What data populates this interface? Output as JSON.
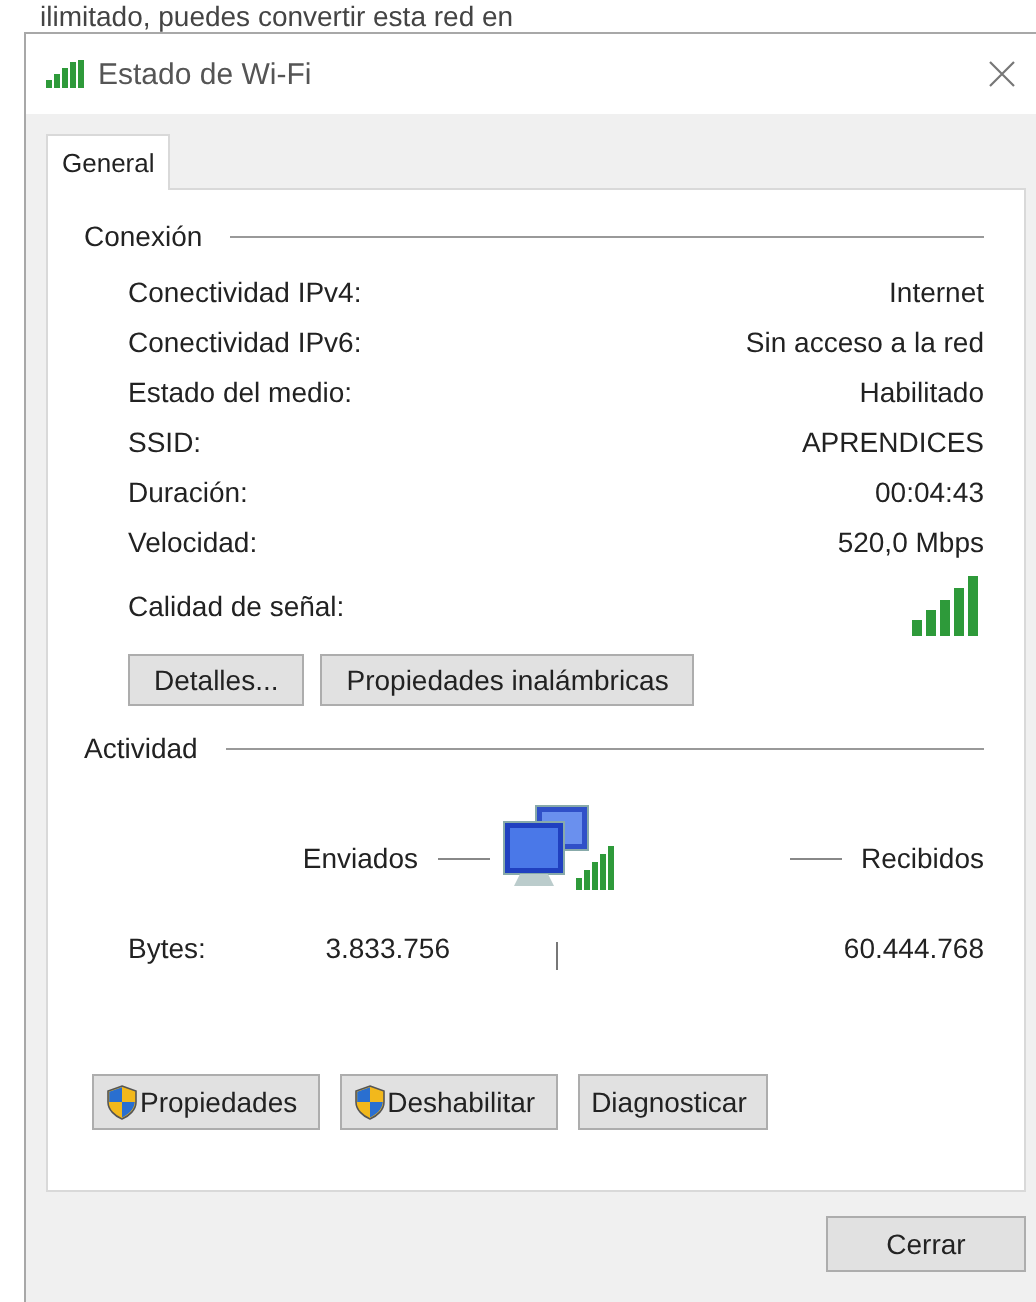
{
  "background_text": "ilimitado, puedes convertir esta red en",
  "window": {
    "title": "Estado de Wi-Fi"
  },
  "tabs": [
    {
      "label": "General",
      "selected": true
    }
  ],
  "connection": {
    "heading": "Conexión",
    "rows": [
      {
        "label": "Conectividad IPv4:",
        "value": "Internet"
      },
      {
        "label": "Conectividad IPv6:",
        "value": "Sin acceso a la red"
      },
      {
        "label": "Estado del medio:",
        "value": "Habilitado"
      },
      {
        "label": "SSID:",
        "value": "APRENDICES"
      },
      {
        "label": "Duración:",
        "value": "00:04:43"
      },
      {
        "label": "Velocidad:",
        "value": "520,0 Mbps"
      }
    ],
    "signal_label": "Calidad de señal:",
    "buttons": [
      "Detalles...",
      "Propiedades inalámbricas"
    ]
  },
  "activity": {
    "heading": "Actividad",
    "sent_label": "Enviados",
    "received_label": "Recibidos",
    "bytes_label": "Bytes:",
    "sent": "3.833.756",
    "received": "60.444.768"
  },
  "actions": [
    {
      "label": "Propiedades",
      "shield": true
    },
    {
      "label": "Deshabilitar",
      "shield": true
    },
    {
      "label": "Diagnosticar",
      "shield": false
    }
  ],
  "close_button": "Cerrar"
}
